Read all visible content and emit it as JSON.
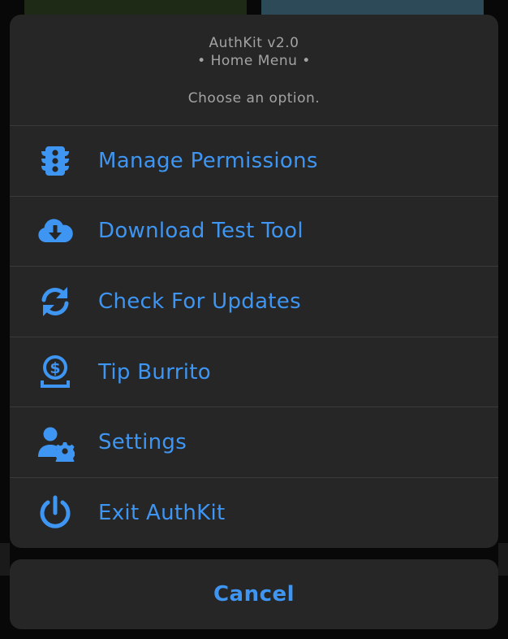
{
  "colors": {
    "accent": "#3e95f2",
    "sheet_bg": "#262626",
    "header_text": "#a3a3a3",
    "divider": "#3a3a3a"
  },
  "sheet": {
    "title": "AuthKit v2.0",
    "subtitle": "• Home Menu •",
    "message": "Choose an option."
  },
  "menu": [
    {
      "label": "Manage Permissions",
      "icon": "traffic-light-icon"
    },
    {
      "label": "Download Test Tool",
      "icon": "cloud-download-icon"
    },
    {
      "label": "Check For Updates",
      "icon": "refresh-icon"
    },
    {
      "label": "Tip Burrito",
      "icon": "dollar-tip-icon"
    },
    {
      "label": "Settings",
      "icon": "user-gear-icon"
    },
    {
      "label": "Exit AuthKit",
      "icon": "power-icon"
    }
  ],
  "cancel": {
    "label": "Cancel"
  }
}
